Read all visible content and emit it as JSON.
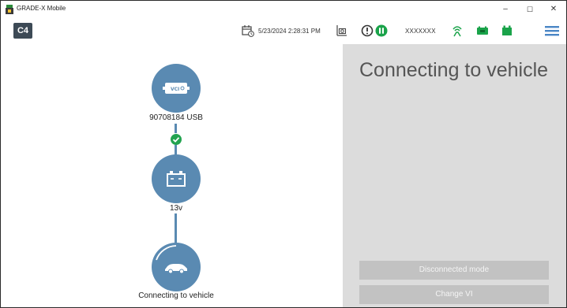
{
  "window": {
    "title": "GRADE-X Mobile",
    "controls": {
      "minimize": "–",
      "maximize": "☐",
      "close": "✕"
    }
  },
  "toolbar": {
    "logo": "C4",
    "datetime": "5/23/2024 2:28:31 PM",
    "user": "XXXXXXX",
    "icons": [
      "calendar-icon",
      "camera-icon",
      "alert-icon",
      "pause-icon",
      "wireless-icon",
      "vci-battery-icon",
      "battery-icon",
      "menu-icon"
    ]
  },
  "connection_chain": {
    "vci": {
      "badge": "VCI",
      "label": "90708184 USB"
    },
    "battery": {
      "label": "13v"
    },
    "vehicle": {
      "label": "Connecting to vehicle"
    }
  },
  "status_panel": {
    "heading": "Connecting to vehicle",
    "buttons": {
      "disconnected_mode": "Disconnected mode",
      "change_vi": "Change VI"
    }
  },
  "colors": {
    "node": "#5a8ab2",
    "connector": "#5a8ab2",
    "check": "#22a350",
    "status_green": "#1aa34a",
    "panel_bg": "#dcdcdc",
    "button_bg": "#c2c2c2",
    "menu": "#4a86c5"
  }
}
